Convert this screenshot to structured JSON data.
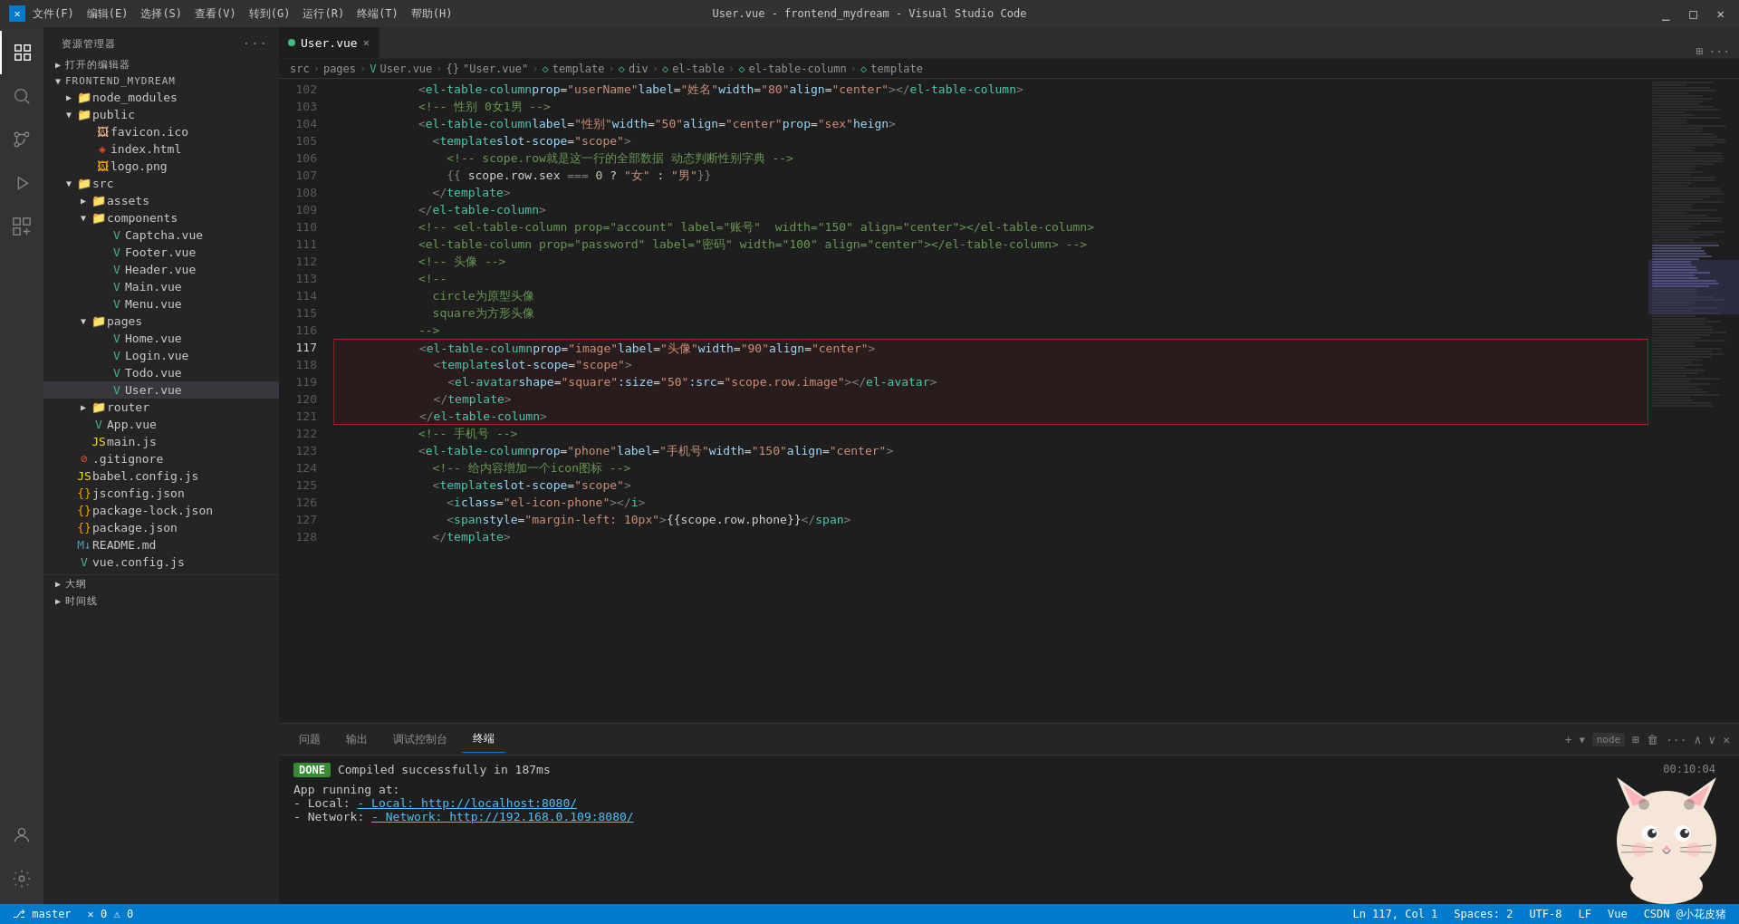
{
  "titleBar": {
    "title": "User.vue - frontend_mydream - Visual Studio Code",
    "menu": [
      "文件(F)",
      "编辑(E)",
      "选择(S)",
      "查看(V)",
      "转到(G)",
      "运行(R)",
      "终端(T)",
      "帮助(H)"
    ]
  },
  "sidebar": {
    "header": "资源管理器",
    "openEditors": "打开的编辑器",
    "projectName": "FRONTEND_MYDREAM",
    "tree": [
      {
        "id": "node_modules",
        "label": "node_modules",
        "type": "folder",
        "depth": 1,
        "expanded": false
      },
      {
        "id": "public",
        "label": "public",
        "type": "folder",
        "depth": 1,
        "expanded": true
      },
      {
        "id": "favicon",
        "label": "favicon.ico",
        "type": "file-ico",
        "depth": 2
      },
      {
        "id": "index-html",
        "label": "index.html",
        "type": "file-html",
        "depth": 2
      },
      {
        "id": "logo-png",
        "label": "logo.png",
        "type": "file-img",
        "depth": 2
      },
      {
        "id": "src",
        "label": "src",
        "type": "folder",
        "depth": 1,
        "expanded": true
      },
      {
        "id": "assets",
        "label": "assets",
        "type": "folder",
        "depth": 2,
        "expanded": false
      },
      {
        "id": "components",
        "label": "components",
        "type": "folder",
        "depth": 2,
        "expanded": true
      },
      {
        "id": "captcha-vue",
        "label": "Captcha.vue",
        "type": "file-vue",
        "depth": 3
      },
      {
        "id": "footer-vue",
        "label": "Footer.vue",
        "type": "file-vue",
        "depth": 3
      },
      {
        "id": "header-vue",
        "label": "Header.vue",
        "type": "file-vue",
        "depth": 3
      },
      {
        "id": "main-vue",
        "label": "Main.vue",
        "type": "file-vue",
        "depth": 3
      },
      {
        "id": "menu-vue",
        "label": "Menu.vue",
        "type": "file-vue",
        "depth": 3
      },
      {
        "id": "pages",
        "label": "pages",
        "type": "folder",
        "depth": 2,
        "expanded": true
      },
      {
        "id": "home-vue",
        "label": "Home.vue",
        "type": "file-vue",
        "depth": 3
      },
      {
        "id": "login-vue",
        "label": "Login.vue",
        "type": "file-vue",
        "depth": 3
      },
      {
        "id": "todo-vue",
        "label": "Todo.vue",
        "type": "file-vue",
        "depth": 3
      },
      {
        "id": "user-vue",
        "label": "User.vue",
        "type": "file-vue",
        "depth": 3,
        "active": true
      },
      {
        "id": "router",
        "label": "router",
        "type": "folder",
        "depth": 2,
        "expanded": false
      },
      {
        "id": "app-vue",
        "label": "App.vue",
        "type": "file-vue",
        "depth": 2
      },
      {
        "id": "main-js",
        "label": "main.js",
        "type": "file-js",
        "depth": 2
      },
      {
        "id": "gitignore",
        "label": ".gitignore",
        "type": "file-git",
        "depth": 1
      },
      {
        "id": "babel-config",
        "label": "babel.config.js",
        "type": "file-js",
        "depth": 1
      },
      {
        "id": "jsconfig",
        "label": "jsconfig.json",
        "type": "file-json",
        "depth": 1
      },
      {
        "id": "package-lock",
        "label": "package-lock.json",
        "type": "file-json",
        "depth": 1
      },
      {
        "id": "package-json",
        "label": "package.json",
        "type": "file-json",
        "depth": 1
      },
      {
        "id": "readme",
        "label": "README.md",
        "type": "file-md",
        "depth": 1
      },
      {
        "id": "vue-config",
        "label": "vue.config.js",
        "type": "file-js",
        "depth": 1
      }
    ],
    "outline": "大纲",
    "timeline": "时间线"
  },
  "editor": {
    "tab": "User.vue",
    "breadcrumb": [
      "src",
      ">",
      "pages",
      ">",
      "User.vue",
      ">",
      "{}",
      "\"User.vue\"",
      ">",
      "template",
      ">",
      "div",
      ">",
      "el-table",
      ">",
      "el-table-column",
      ">",
      "template"
    ],
    "lines": [
      {
        "num": 102,
        "content": "            <el-table-column  prop=\"userName\" label=\"姓名\"   width=\"80\"  align=\"center\" ></el-table-column>"
      },
      {
        "num": 103,
        "content": "            <!-- 性别 0女1男 -->"
      },
      {
        "num": 104,
        "content": "            <el-table-column label=\"性别\" width=\"50\" align=\"center\" prop=\"sex\" heign>"
      },
      {
        "num": 105,
        "content": "              <template slot-scope=\"scope\">"
      },
      {
        "num": 106,
        "content": "                <!-- scope.row就是这一行的全部数据 动态判断性别字典 -->"
      },
      {
        "num": 107,
        "content": "                {{ scope.row.sex === 0 ? \"女\" : \"男\"}}"
      },
      {
        "num": 108,
        "content": "              </template>"
      },
      {
        "num": 109,
        "content": "            </el-table-column>"
      },
      {
        "num": 110,
        "content": "            <!-- <el-table-column prop=\"account\" label=\"账号\"  width=\"150\" align=\"center\"></el-table-column>"
      },
      {
        "num": 111,
        "content": "            <el-table-column prop=\"password\" label=\"密码\" width=\"100\" align=\"center\"></el-table-column> -->"
      },
      {
        "num": 112,
        "content": "            <!-- 头像 -->"
      },
      {
        "num": 113,
        "content": "            <!--"
      },
      {
        "num": 114,
        "content": "              circle为原型头像"
      },
      {
        "num": 115,
        "content": "              square为方形头像"
      },
      {
        "num": 116,
        "content": "            -->"
      },
      {
        "num": 117,
        "content": "            <el-table-column prop=\"image\" label=\"头像\" width=\"90\"   align=\"center\">",
        "highlight": "top"
      },
      {
        "num": 118,
        "content": "              <template slot-scope=\"scope\">",
        "highlight": "mid"
      },
      {
        "num": 119,
        "content": "                <el-avatar  shape=\"square\" :size=\"50\"  :src=\"scope.row.image\"></el-avatar>",
        "highlight": "mid"
      },
      {
        "num": 120,
        "content": "              </template>",
        "highlight": "mid"
      },
      {
        "num": 121,
        "content": "            </el-table-column>",
        "highlight": "bottom"
      },
      {
        "num": 122,
        "content": "            <!-- 手机号 -->"
      },
      {
        "num": 123,
        "content": "            <el-table-column prop=\"phone\" label=\"手机号\" width=\"150\" align=\"center\">"
      },
      {
        "num": 124,
        "content": "              <!-- 给内容增加一个icon图标 -->"
      },
      {
        "num": 125,
        "content": "              <template slot-scope=\"scope\">"
      },
      {
        "num": 126,
        "content": "                <i class=\"el-icon-phone\"></i>"
      },
      {
        "num": 127,
        "content": "                <span style=\"margin-left: 10px\">{{scope.row.phone}}</span>"
      },
      {
        "num": 128,
        "content": "              </template>"
      }
    ]
  },
  "panel": {
    "tabs": [
      "问题",
      "输出",
      "调试控制台",
      "终端"
    ],
    "activeTab": "终端",
    "terminal": {
      "doneLabel": "DONE",
      "compiledMsg": "Compiled successfully in 187ms",
      "appRunning": "App running at:",
      "local": "- Local:   http://localhost:8080/",
      "network": "- Network: http://192.168.0.109:8080/",
      "timestamp": "00:10:04"
    }
  },
  "statusBar": {
    "branch": "master",
    "errors": "0",
    "warnings": "0",
    "ln": "Ln 117, Col 1",
    "spaces": "Spaces: 2",
    "encoding": "UTF-8",
    "lineEnd": "LF",
    "lang": "Vue",
    "credit": "CSDN @小花皮猪"
  },
  "icons": {
    "explorer": "⬜",
    "search": "🔍",
    "git": "⎇",
    "run": "▷",
    "extensions": "⧉"
  }
}
